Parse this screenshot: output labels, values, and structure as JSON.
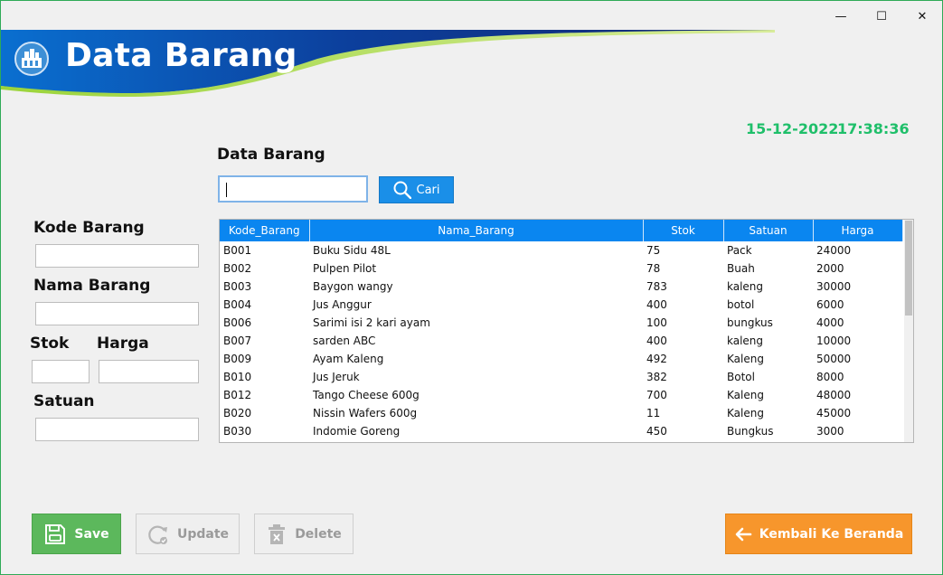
{
  "window": {
    "controls": {
      "minimize": "—",
      "maximize": "☐",
      "close": "✕"
    }
  },
  "header": {
    "title": "Data Barang",
    "logo_icon": "warehouse-logo-icon"
  },
  "status": {
    "date": "15-12-2022",
    "time": "17:38:36"
  },
  "search": {
    "section_title": "Data Barang",
    "value": "",
    "button_label": "Cari"
  },
  "form": {
    "kode_label": "Kode Barang",
    "nama_label": "Nama Barang",
    "stok_label": "Stok",
    "harga_label": "Harga",
    "satuan_label": "Satuan"
  },
  "table": {
    "headers": [
      "Kode_Barang",
      "Nama_Barang",
      "Stok",
      "Satuan",
      "Harga"
    ],
    "rows": [
      [
        "B001",
        "Buku Sidu 48L",
        "75",
        "Pack",
        "24000"
      ],
      [
        "B002",
        "Pulpen Pilot",
        "78",
        "Buah",
        "2000"
      ],
      [
        "B003",
        "Baygon wangy",
        "783",
        "kaleng",
        "30000"
      ],
      [
        "B004",
        "Jus Anggur",
        "400",
        "botol",
        "6000"
      ],
      [
        "B006",
        "Sarimi isi 2 kari ayam",
        "100",
        "bungkus",
        "4000"
      ],
      [
        "B007",
        "sarden ABC",
        "400",
        "kaleng",
        "10000"
      ],
      [
        "B009",
        "Ayam Kaleng",
        "492",
        "Kaleng",
        "50000"
      ],
      [
        "B010",
        "Jus Jeruk",
        "382",
        "Botol",
        "8000"
      ],
      [
        "B012",
        "Tango Cheese 600g",
        "700",
        "Kaleng",
        "48000"
      ],
      [
        "B020",
        "Nissin Wafers 600g",
        "11",
        "Kaleng",
        "45000"
      ],
      [
        "B030",
        "Indomie Goreng",
        "450",
        "Bungkus",
        "3000"
      ]
    ]
  },
  "buttons": {
    "save": "Save",
    "update": "Update",
    "delete": "Delete",
    "back": "Kembali Ke Beranda"
  },
  "colors": {
    "header_blue": "#0a86f0",
    "save_green": "#5cb85c",
    "back_orange": "#f7962c",
    "datetime_green": "#1fbf6a"
  }
}
